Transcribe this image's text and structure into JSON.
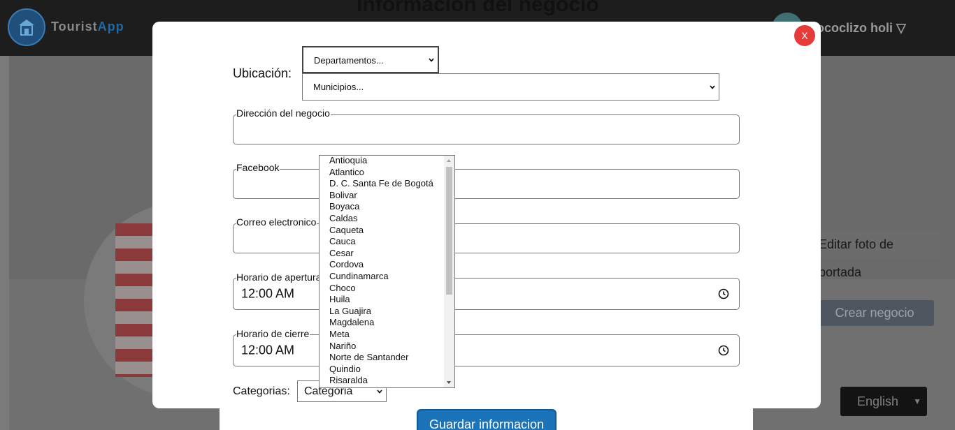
{
  "app": {
    "brand_main": "Tourist",
    "brand_accent": "App",
    "page_title": "Información del negocio",
    "user_name": "sococlizo holi ▽"
  },
  "background": {
    "edit_cover_label": "Editar foto de portada",
    "create_business_label": "Crear negocio",
    "language_label": "English",
    "save_label": "Guardar informacion"
  },
  "modal": {
    "close_label": "X",
    "ubicacion_label": "Ubicación:",
    "departamentos_placeholder": "Departamentos...",
    "municipios_placeholder": "Municipios...",
    "direccion_label": "Dirección del negocio",
    "facebook_label": "Facebook",
    "correo_label": "Correo electronico",
    "apertura_label": "Horario de apertura",
    "apertura_value": "12:00 AM",
    "cierre_label": "Horario de cierre",
    "cierre_value": "12:00 AM",
    "categorias_label": "Categorias:",
    "categoria_value": "Categoria"
  },
  "dropdown": {
    "options": [
      "Antioquia",
      "Atlantico",
      "D. C. Santa Fe de Bogotá",
      "Bolivar",
      "Boyaca",
      "Caldas",
      "Caqueta",
      "Cauca",
      "Cesar",
      "Cordova",
      "Cundinamarca",
      "Choco",
      "Huila",
      "La Guajira",
      "Magdalena",
      "Meta",
      "Nariño",
      "Norte de Santander",
      "Quindio",
      "Risaralda"
    ]
  },
  "colors": {
    "close_button": "#e53b3b",
    "save_button": "#1b73b9",
    "overlay": "#6e6e6e"
  },
  "icons": {
    "logo": "store-pin-icon",
    "close": "close-icon",
    "clock": "clock-icon",
    "chevron": "chevron-down-icon"
  }
}
